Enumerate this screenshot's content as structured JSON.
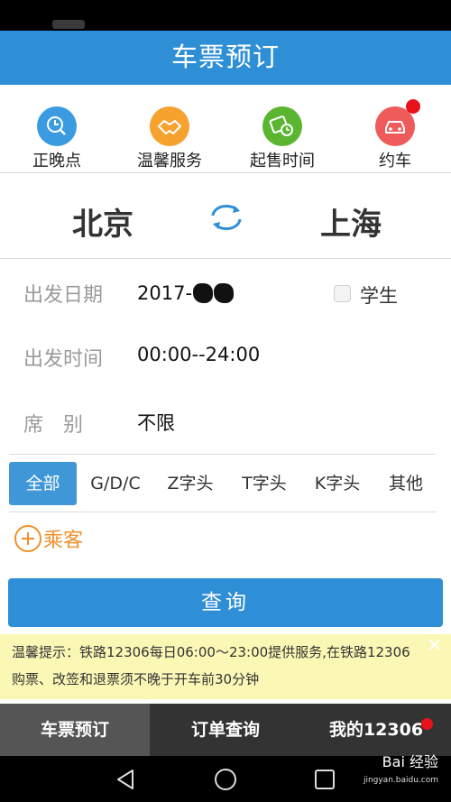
{
  "header": {
    "title": "车票预订"
  },
  "quick_links": [
    {
      "label": "正晚点",
      "icon": "clock-search-icon",
      "color": "#3b9be0"
    },
    {
      "label": "温馨服务",
      "icon": "handshake-icon",
      "color": "#f6a22f"
    },
    {
      "label": "起售时间",
      "icon": "ticket-clock-icon",
      "color": "#5cb531"
    },
    {
      "label": "约车",
      "icon": "car-icon",
      "color": "#ef5b5b"
    }
  ],
  "route": {
    "from": "北京",
    "to": "上海"
  },
  "form": {
    "date_label": "出发日期",
    "date_value": "2017-",
    "student_label": "学生",
    "time_label": "出发时间",
    "time_value": "00:00--24:00",
    "seat_label": "席　别",
    "seat_value": "不限"
  },
  "train_types": [
    "全部",
    "G/D/C",
    "Z字头",
    "T字头",
    "K字头",
    "其他"
  ],
  "passenger": {
    "label": "乘客"
  },
  "query_button": "查询",
  "tip": {
    "text": "温馨提示：铁路12306每日06:00～23:00提供服务,在铁路12306购票、改签和退票须不晚于开车前30分钟"
  },
  "tabs": [
    "车票预订",
    "订单查询",
    "我的12306"
  ],
  "watermark": {
    "brand": "Bai 经验",
    "url": "jingyan.baidu.com"
  },
  "colors": {
    "primary": "#2f8fd6",
    "accent": "#f0902a",
    "badge": "#e8121a"
  }
}
